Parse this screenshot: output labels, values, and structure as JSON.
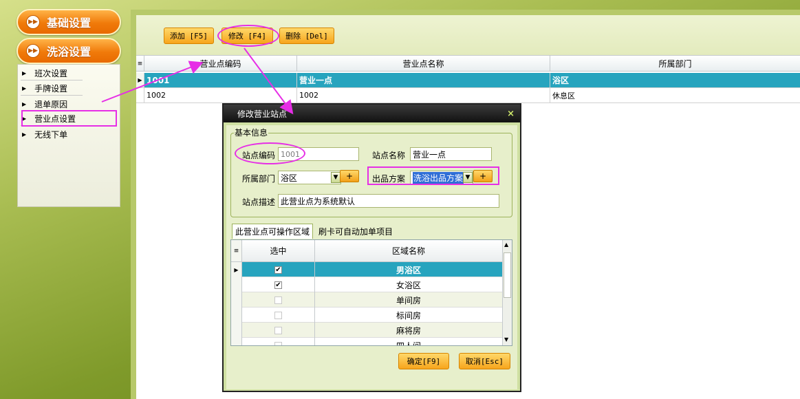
{
  "nav": {
    "sections": [
      {
        "label": "基础设置"
      },
      {
        "label": "洗浴设置"
      }
    ],
    "items": [
      {
        "label": "班次设置"
      },
      {
        "label": "手牌设置"
      },
      {
        "label": "退单原因"
      },
      {
        "label": "营业点设置"
      },
      {
        "label": "无线下单"
      }
    ]
  },
  "toolbar": {
    "add": "添加 [F5]",
    "edit": "修改 [F4]",
    "delete": "删除 [Del]"
  },
  "grid": {
    "columns": [
      "营业点编码",
      "营业点名称",
      "所属部门"
    ],
    "rows": [
      {
        "code": "1001",
        "name": "营业一点",
        "dept": "浴区",
        "selected": true
      },
      {
        "code": "1002",
        "name": "1002",
        "dept": "休息区",
        "selected": false
      }
    ]
  },
  "dialog": {
    "title": "修改营业站点",
    "close_icon": "×",
    "group_label": "基本信息",
    "station_code_label": "站点编码",
    "station_code_value": "1001",
    "station_name_label": "站点名称",
    "station_name_value": "营业一点",
    "dept_label": "所属部门",
    "dept_value": "浴区",
    "plan_label": "出品方案",
    "plan_value": "洗浴出品方案",
    "desc_label": "站点描述",
    "desc_value": "此营业点为系统默认",
    "plus": "+",
    "tabs": [
      "此营业点可操作区域",
      "刷卡可自动加单项目"
    ],
    "area_grid": {
      "columns": [
        "选中",
        "区域名称"
      ],
      "rows": [
        {
          "checked": true,
          "name": "男浴区",
          "selected": true
        },
        {
          "checked": true,
          "name": "女浴区",
          "selected": false
        },
        {
          "checked": false,
          "name": "单间房",
          "selected": false
        },
        {
          "checked": false,
          "name": "标间房",
          "selected": false
        },
        {
          "checked": false,
          "name": "麻将房",
          "selected": false
        },
        {
          "checked": false,
          "name": "四人间",
          "selected": false
        }
      ]
    },
    "ok": "确定[F9]",
    "cancel": "取消[Esc]"
  },
  "colors": {
    "selection": "#27a4be",
    "annotation": "#e62ee6",
    "button": "#f7a51c"
  }
}
